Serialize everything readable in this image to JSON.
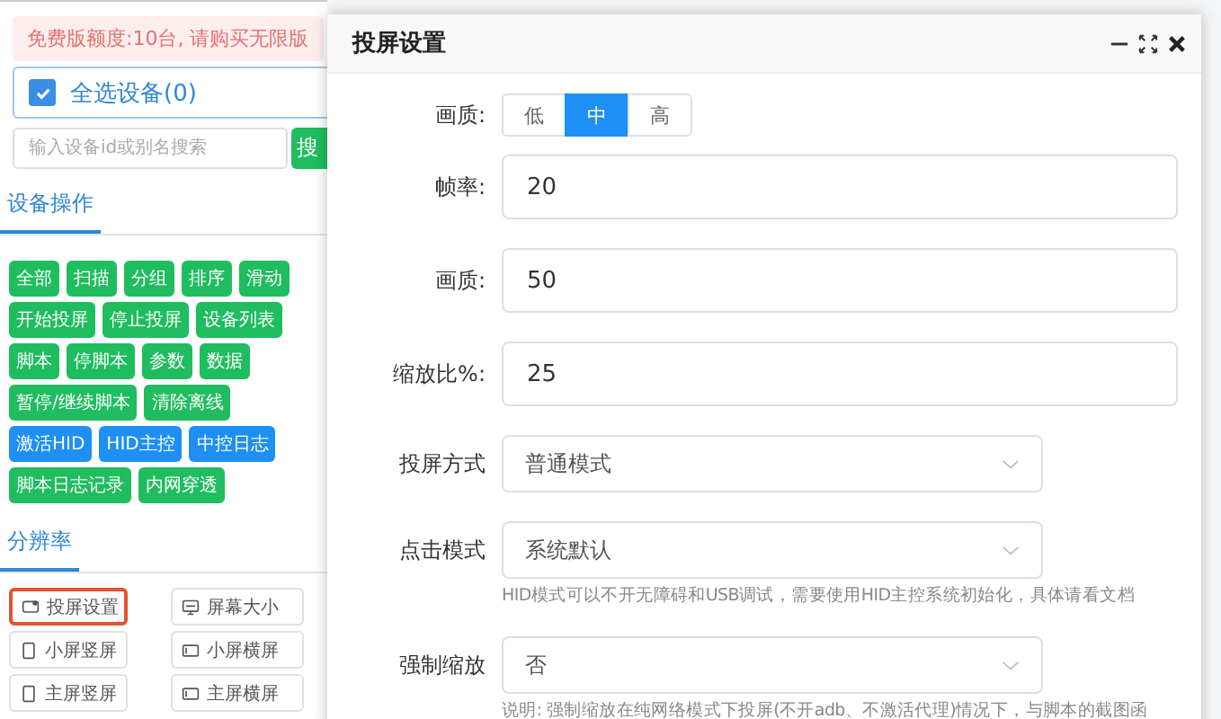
{
  "sidebar": {
    "notice": "免费版额度:10台, 请购买无限版",
    "select_all": {
      "label": "全选设备(0)",
      "checked": true
    },
    "search": {
      "placeholder": "输入设备id或别名搜索",
      "button": "搜"
    },
    "tabs": [
      {
        "label": "设备操作",
        "selected": true
      }
    ],
    "action_buttons": [
      {
        "label": "全部",
        "color": "#1fbd5f"
      },
      {
        "label": "扫描",
        "color": "#1fbd5f"
      },
      {
        "label": "分组",
        "color": "#1fbd5f"
      },
      {
        "label": "排序",
        "color": "#1fbd5f"
      },
      {
        "label": "滑动",
        "color": "#1fbd5f"
      },
      {
        "label": "开始投屏",
        "color": "#1fbd5f"
      },
      {
        "label": "停止投屏",
        "color": "#1fbd5f"
      },
      {
        "label": "设备列表",
        "color": "#1fbd5f"
      },
      {
        "label": "脚本",
        "color": "#1fbd5f"
      },
      {
        "label": "停脚本",
        "color": "#1fbd5f"
      },
      {
        "label": "参数",
        "color": "#1fbd5f"
      },
      {
        "label": "数据",
        "color": "#1fbd5f"
      },
      {
        "label": "暂停/继续脚本",
        "color": "#1fbd5f"
      },
      {
        "label": "清除离线",
        "color": "#1fbd5f"
      },
      {
        "label": "激活HID",
        "color": "#1e8ff5"
      },
      {
        "label": "HID主控",
        "color": "#1e8ff5"
      },
      {
        "label": "中控日志",
        "color": "#1e8ff5"
      },
      {
        "label": "脚本日志记录",
        "color": "#1fbd5f"
      },
      {
        "label": "内网穿透",
        "color": "#1fbd5f"
      }
    ],
    "section_tabs": [
      {
        "label": "分辨率",
        "selected": true
      }
    ],
    "resolution_buttons": [
      {
        "label": "投屏设置",
        "kind": "screen",
        "selected": true
      },
      {
        "label": "屏幕大小",
        "kind": "monitor",
        "selected": false
      },
      {
        "label": "小屏竖屏",
        "kind": "portrait",
        "selected": false
      },
      {
        "label": "小屏横屏",
        "kind": "landscape",
        "selected": false
      },
      {
        "label": "主屏竖屏",
        "kind": "portrait",
        "selected": false
      },
      {
        "label": "主屏横屏",
        "kind": "landscape",
        "selected": false
      }
    ]
  },
  "dialog": {
    "title": "投屏设置",
    "fields": [
      {
        "kind": "segmented",
        "label": "画质:",
        "options": [
          {
            "label": "低",
            "selected": false
          },
          {
            "label": "中",
            "selected": true
          },
          {
            "label": "高",
            "selected": false
          }
        ]
      },
      {
        "kind": "input",
        "label": "帧率:",
        "value": "20"
      },
      {
        "kind": "input",
        "label": "画质:",
        "value": "50"
      },
      {
        "kind": "input",
        "label": "缩放比%:",
        "value": "25"
      },
      {
        "kind": "select",
        "label": "投屏方式",
        "value": "普通模式"
      },
      {
        "kind": "select",
        "label": "点击模式",
        "value": "系统默认",
        "hint": "HID模式可以不开无障碍和USB调试，需要使用HID主控系统初始化，具体请看文档"
      },
      {
        "kind": "select",
        "label": "强制缩放",
        "value": "否",
        "hint": "说明: 强制缩放在纯网络模式下投屏(不开adb、不激活代理)情况下，与脚本的截图函"
      }
    ]
  }
}
